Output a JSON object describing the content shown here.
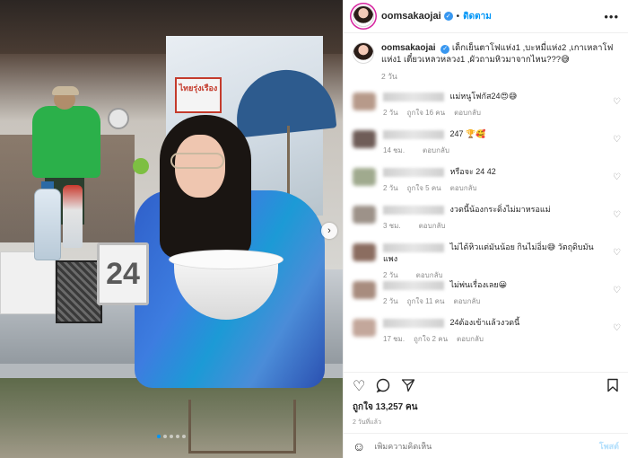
{
  "post": {
    "username": "oomsakaojai",
    "follow_label": "ติดตาม",
    "separator": "•",
    "more_icon": "more-dots-icon",
    "caption": "เด็กเย็นตาโฟแห่ง1 ,บะหมี่แห่ง2 ,เกาเหลาโฟแห่ง1 เตี๋ยวเหลวหลวง1 ,ผัวถามหิวมาจากไหน???😅",
    "caption_age": "2 วัน"
  },
  "photo": {
    "shop_sign": "ไทยรุ่งเรือง",
    "table_number": "24",
    "carousel_next": "›"
  },
  "comments": [
    {
      "text": "แม่หนูโฟกัส24😍😅",
      "time": "2 วัน",
      "likes": "ถูกใจ 16 คน",
      "reply": "ตอบกลับ",
      "avatar_color": "#b79a8a"
    },
    {
      "text": "247 🏆🥰",
      "time": "14 ชม.",
      "likes": "",
      "reply": "ตอบกลับ",
      "avatar_color": "#6f5d58"
    },
    {
      "text": "หรือจะ 24 42",
      "time": "2 วัน",
      "likes": "ถูกใจ 5 คน",
      "reply": "ตอบกลับ",
      "avatar_color": "#a0aa8e"
    },
    {
      "text": "งวดนี้น้องกระดิ่งไม่มาหรอแม่",
      "time": "3 ชม.",
      "likes": "",
      "reply": "ตอบกลับ",
      "avatar_color": "#9d9289"
    },
    {
      "text": "ไม่ได้หิวแต่มันน้อย กินไม่อิ่ม😅 วัตถุดิบมันแพง",
      "time": "2 วัน",
      "likes": "",
      "reply": "ตอบกลับ",
      "avatar_color": "#8b6d60"
    },
    {
      "text": "ไม่พ่นเรื่องเลย😀",
      "time": "2 วัน",
      "likes": "ถูกใจ 11 คน",
      "reply": "ตอบกลับ",
      "avatar_color": "#a88c7e"
    },
    {
      "text": "24ต้องเข้าแล้วงวดนี้",
      "time": "17 ชม.",
      "likes": "ถูกใจ 2 คน",
      "reply": "ตอบกลับ",
      "avatar_color": "#c3a79b"
    }
  ],
  "actions": {
    "like_icon": "heart-icon",
    "comment_icon": "comment-icon",
    "share_icon": "share-icon",
    "save_icon": "bookmark-icon"
  },
  "likes_text": "ถูกใจ 13,257 คน",
  "timestamp": "2 วันที่แล้ว",
  "add_comment": {
    "placeholder": "เพิ่มความคิดเห็น",
    "post_label": "โพสต์"
  }
}
